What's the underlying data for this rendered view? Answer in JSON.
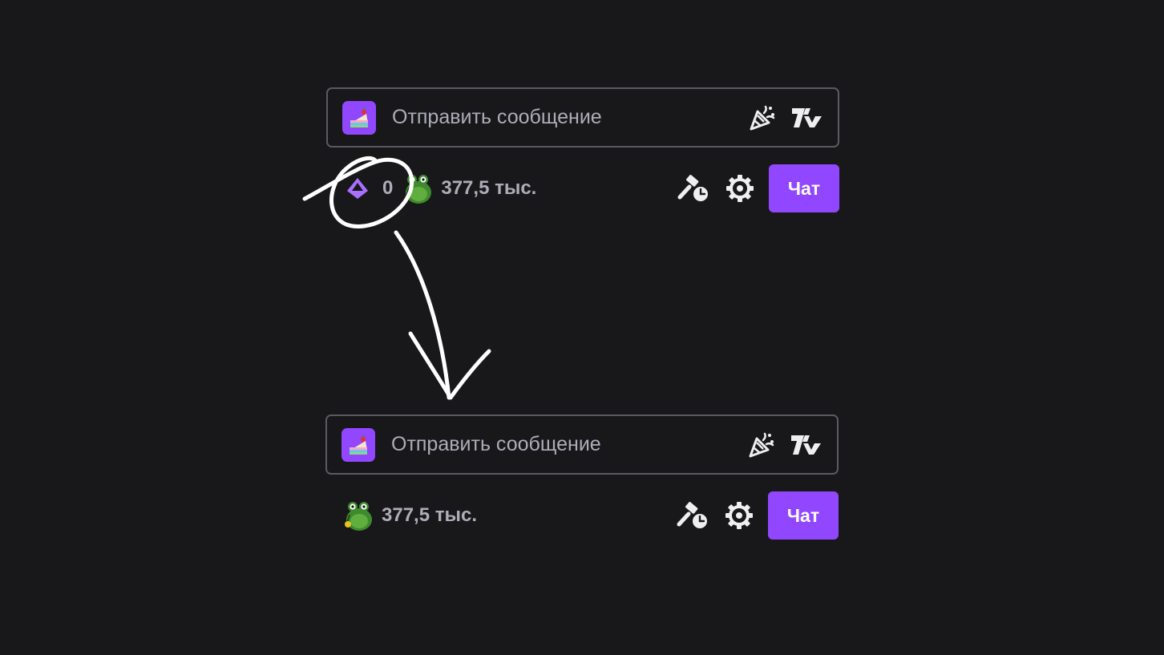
{
  "top_panel": {
    "placeholder": "Отправить сообщение",
    "points_value": "0",
    "channel_points": "377,5 тыс.",
    "chat_button": "Чат"
  },
  "bottom_panel": {
    "placeholder": "Отправить сообщение",
    "channel_points": "377,5 тыс.",
    "chat_button": "Чат"
  },
  "icons": {
    "badge": "cake-badge-icon",
    "celebrate": "party-popper-icon",
    "extension": "7tv-logo-icon",
    "points": "bits-diamond-icon",
    "channel_points": "frog-emote-icon",
    "mod": "gavel-clock-icon",
    "settings": "gear-icon"
  },
  "colors": {
    "background": "#18181b",
    "accent": "#9147ff",
    "border": "#5a5a60",
    "text_muted": "#adadb8"
  }
}
